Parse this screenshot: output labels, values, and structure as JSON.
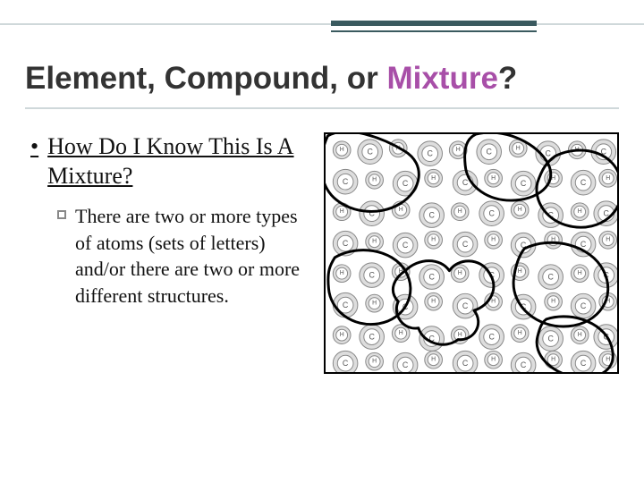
{
  "title": {
    "pre": "Element, Compound, or ",
    "accent": "Mixture",
    "post": "?"
  },
  "bullet": "How Do I Know This Is A Mixture?",
  "subbullet": "There are two or more types of atoms (sets of letters) and/or there are two or more different structures.",
  "atom_labels": {
    "c": "C",
    "h": "H"
  }
}
